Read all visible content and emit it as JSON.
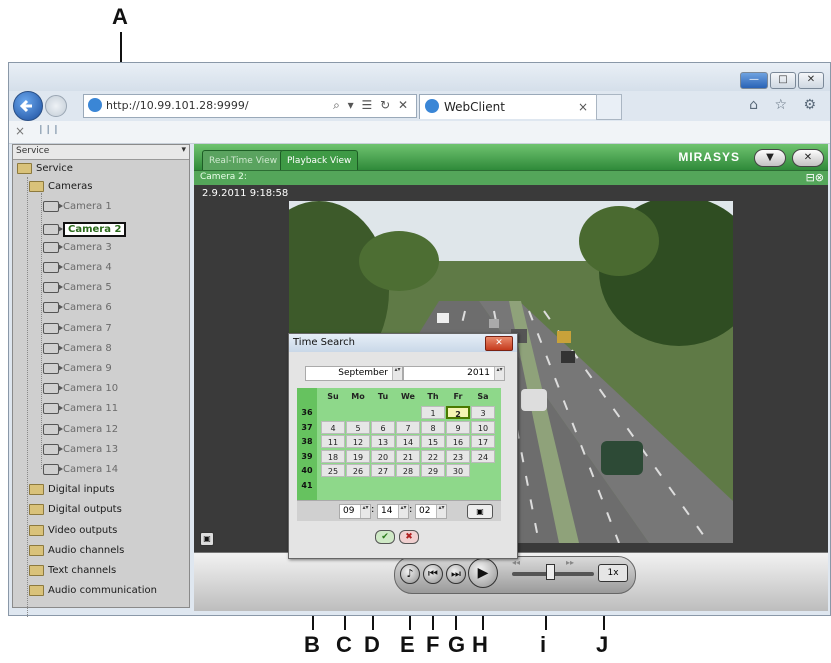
{
  "callouts": [
    "A",
    "B",
    "C",
    "D",
    "E",
    "F",
    "G",
    "H",
    "i",
    "J"
  ],
  "browser": {
    "url": "http://10.99.101.28:9999/",
    "url_controls": "⌕ ▾ ☰ ↻ ✕",
    "tab_title": "WebClient",
    "tab_close": "×",
    "toolbar_icons": "⌂ ☆ ⚙",
    "xbar_close": "×",
    "xbar_signal": "❙❙❙",
    "window_buttons": [
      "—",
      "□",
      "✕"
    ]
  },
  "tree": {
    "header": "Service",
    "items": [
      {
        "label": "Service",
        "dim": false
      },
      {
        "label": "Cameras",
        "dim": false
      },
      {
        "label": "Camera 1",
        "dim": true
      },
      {
        "label": "Camera 2",
        "dim": false,
        "selected": true
      },
      {
        "label": "Camera 3",
        "dim": true
      },
      {
        "label": "Camera 4",
        "dim": true
      },
      {
        "label": "Camera 5",
        "dim": true
      },
      {
        "label": "Camera 6",
        "dim": true
      },
      {
        "label": "Camera 7",
        "dim": true
      },
      {
        "label": "Camera 8",
        "dim": true
      },
      {
        "label": "Camera 9",
        "dim": true
      },
      {
        "label": "Camera 10",
        "dim": true
      },
      {
        "label": "Camera 11",
        "dim": true
      },
      {
        "label": "Camera 12",
        "dim": true
      },
      {
        "label": "Camera 13",
        "dim": true
      },
      {
        "label": "Camera 14",
        "dim": true
      },
      {
        "label": "Digital inputs",
        "dim": false
      },
      {
        "label": "Digital outputs",
        "dim": false
      },
      {
        "label": "Video outputs",
        "dim": false
      },
      {
        "label": "Audio channels",
        "dim": false
      },
      {
        "label": "Text channels",
        "dim": false
      },
      {
        "label": "Audio communication",
        "dim": false
      }
    ]
  },
  "app": {
    "tab_realtime": "Real-Time View",
    "tab_playback": "Playback View",
    "logo": "MIRASYS",
    "pill_menu": "▼",
    "pill_close": "✕",
    "camera_title": "Camera 2:",
    "timestamp": "2.9.2011 9:18:58",
    "subbar_icons": "⊟⊗",
    "side_button": "▣",
    "speed": "1x",
    "rewind_icon": "◂◂",
    "forward_icon": "▸▸",
    "buttons": {
      "e": "♪",
      "f": "⏮",
      "g": "⏭",
      "h": "▶"
    }
  },
  "dialog": {
    "title": "Time Search",
    "close": "✕",
    "month": "September",
    "year": "2011",
    "spin_arrows": "▴▾",
    "day_headers": [
      "Su",
      "Mo",
      "Tu",
      "We",
      "Th",
      "Fr",
      "Sa"
    ],
    "weeks": [
      "36",
      "37",
      "38",
      "39",
      "40",
      "41"
    ],
    "rows": [
      [
        "",
        "",
        "",
        "",
        "1",
        "2",
        "3"
      ],
      [
        "4",
        "5",
        "6",
        "7",
        "8",
        "9",
        "10"
      ],
      [
        "11",
        "12",
        "13",
        "14",
        "15",
        "16",
        "17"
      ],
      [
        "18",
        "19",
        "20",
        "21",
        "22",
        "23",
        "24"
      ],
      [
        "25",
        "26",
        "27",
        "28",
        "29",
        "30",
        ""
      ],
      [
        "",
        "",
        "",
        "",
        "",
        "",
        ""
      ]
    ],
    "selected_day": "2",
    "hour": "09",
    "minute": "14",
    "second": "02",
    "time_sep": ":",
    "ok_icon": "✔",
    "cancel_icon": "✖",
    "clock_button": "▣"
  }
}
